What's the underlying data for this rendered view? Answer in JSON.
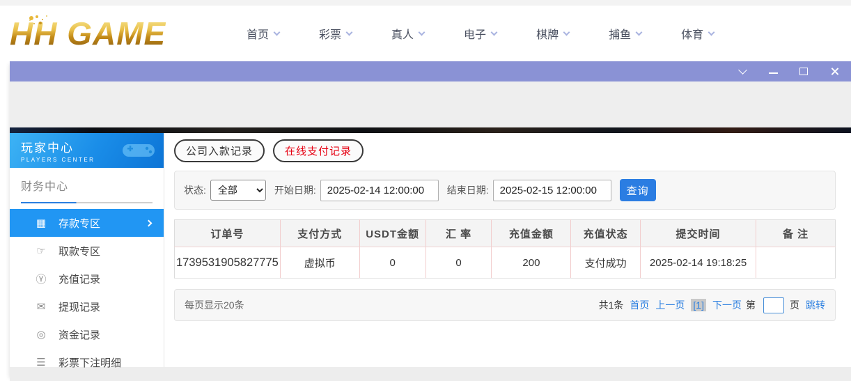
{
  "brand": {
    "logo_text": "HH GAME"
  },
  "nav": {
    "items": [
      {
        "label": "首页"
      },
      {
        "label": "彩票"
      },
      {
        "label": "真人"
      },
      {
        "label": "电子"
      },
      {
        "label": "棋牌"
      },
      {
        "label": "捕鱼"
      },
      {
        "label": "体育"
      }
    ]
  },
  "sidebar": {
    "title": "玩家中心",
    "subtitle": "PLAYERS CENTER",
    "section_label": "财务中心",
    "items": [
      {
        "label": "存款专区",
        "icon": "deposit-card-icon",
        "glyph": "▦",
        "active": true
      },
      {
        "label": "取款专区",
        "icon": "withdraw-hand-icon",
        "glyph": "☞",
        "active": false
      },
      {
        "label": "充值记录",
        "icon": "money-bag-icon",
        "glyph": "Ⓨ",
        "active": false
      },
      {
        "label": "提现记录",
        "icon": "wallet-icon",
        "glyph": "✉",
        "active": false
      },
      {
        "label": "资金记录",
        "icon": "funds-coin-icon",
        "glyph": "◎",
        "active": false
      },
      {
        "label": "彩票下注明细",
        "icon": "bet-list-icon",
        "glyph": "☰",
        "active": false
      }
    ]
  },
  "tabs": [
    {
      "label": "公司入款记录",
      "active": false
    },
    {
      "label": "在线支付记录",
      "active": true
    }
  ],
  "filters": {
    "status_label": "状态:",
    "status_value": "全部",
    "start_label": "开始日期:",
    "start_value": "2025-02-14 12:00:00",
    "end_label": "结束日期:",
    "end_value": "2025-02-15 12:00:00",
    "search_label": "查询"
  },
  "table": {
    "headers": [
      "订单号",
      "支付方式",
      "USDT金额",
      "汇 率",
      "充值金额",
      "充值状态",
      "提交时间",
      "备 注"
    ],
    "rows": [
      [
        "1739531905827775",
        "虚拟币",
        "0",
        "0",
        "200",
        "支付成功",
        "2025-02-14 19:18:25",
        ""
      ]
    ]
  },
  "pagination": {
    "page_size_text": "每页显示20条",
    "total_text": "共1条",
    "first_label": "首页",
    "prev_label": "上一页",
    "current_label": "[1]",
    "next_label": "下一页",
    "jump_prefix": "第",
    "jump_suffix": "页",
    "jump_label": "跳转"
  },
  "colors": {
    "accent_blue": "#2196f3",
    "button_blue": "#2b7de2",
    "link_blue": "#2b7fe0",
    "tab_red": "#e60012",
    "titlebar_purple": "#8a92d5",
    "logo_gold": "#d9a72a"
  }
}
